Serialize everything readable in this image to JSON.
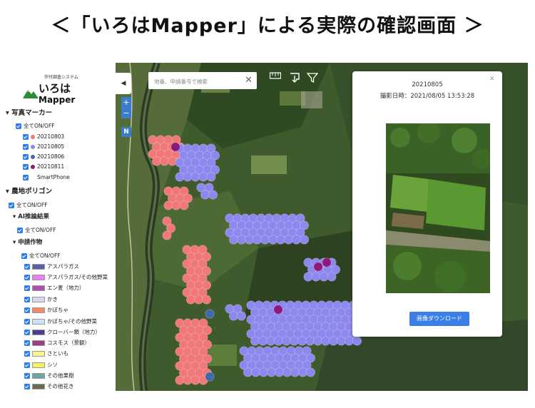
{
  "headline": "＜「いろはMapper」による実際の確認画面 ＞",
  "logo": {
    "system": "作付調査システム",
    "name_jp": "いろは",
    "name_en": "Mapper"
  },
  "photo_markers": {
    "title": "写真マーカー",
    "all": "全てON/OFF",
    "items": [
      {
        "label": "20210803",
        "color": "#f07878"
      },
      {
        "label": "20210805",
        "color": "#8c88ee"
      },
      {
        "label": "20210806",
        "color": "#3e6aa8"
      },
      {
        "label": "20210811",
        "color": "#8b1a7a"
      },
      {
        "label": "SmartPhone",
        "color": ""
      }
    ]
  },
  "polygons": {
    "title": "農地ポリゴン",
    "all": "全てON/OFF",
    "ai": {
      "title": "AI推論結果",
      "all": "全てON/OFF"
    },
    "crops": {
      "title": "申請作物",
      "all": "全てON/OFF",
      "items": [
        {
          "label": "アスパラガス",
          "color": "#5a5fa6"
        },
        {
          "label": "アスパラガス/その他野菜",
          "color": "#f07df0"
        },
        {
          "label": "エン麦（地力）",
          "color": "#b04fb0"
        },
        {
          "label": "かき",
          "color": "#d8d8f4"
        },
        {
          "label": "かぼちゃ",
          "color": "#f28a6a"
        },
        {
          "label": "かぼちゃ/その他野菜",
          "color": "#cfe0f6"
        },
        {
          "label": "クローバー類（地力）",
          "color": "#4a3c92"
        },
        {
          "label": "コスモス（景観）",
          "color": "#9a3e86"
        },
        {
          "label": "さといも",
          "color": "#f6f48a"
        },
        {
          "label": "シソ",
          "color": "#f2f25e"
        },
        {
          "label": "その他果樹",
          "color": "#6aa6a6"
        },
        {
          "label": "その他花き",
          "color": "#6a6a4c"
        }
      ]
    }
  },
  "map": {
    "search_placeholder": "地番、申請番号で検索",
    "north": "N"
  },
  "popup": {
    "date": "20210805",
    "timestamp": "撮影日時：2021/08/05 13:53:28",
    "download": "画像ダウンロード"
  }
}
